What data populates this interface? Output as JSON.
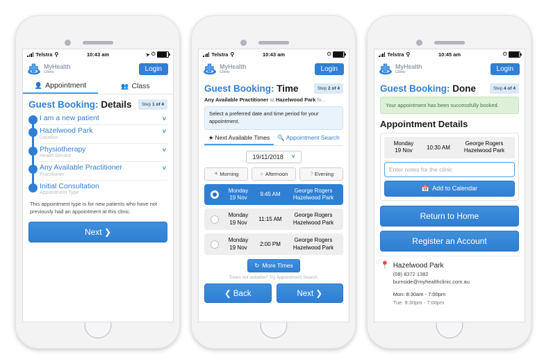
{
  "brand": {
    "name_line1": "MyHealth",
    "name_line2": "Clinic",
    "accent": "#2f7fd4",
    "logo_icon": "medical-cross-logo"
  },
  "common": {
    "login_label": "Login",
    "carrier": "Telstra",
    "wifi_icon": "wifi-icon",
    "signal_icon": "signal-bars-icon",
    "battery_icon": "battery-icon",
    "location_icon": "location-arrow-icon",
    "lock_icon": "rotation-lock-icon"
  },
  "phone1": {
    "status": {
      "time": "10:43 am"
    },
    "tabs": [
      {
        "label": "Appointment",
        "icon": "person-icon",
        "active": true
      },
      {
        "label": "Class",
        "icon": "group-icon",
        "active": false
      }
    ],
    "title_prefix": "Guest Booking:",
    "title_main": "Details",
    "step_prefix": "Step",
    "step_value": "1 of 4",
    "timeline": [
      {
        "label": "I am a new patient",
        "sub": "",
        "chevron": "chevron-down-icon"
      },
      {
        "label": "Hazelwood Park",
        "sub": "Location",
        "chevron": "chevron-down-icon"
      },
      {
        "label": "Physiotherapy",
        "sub": "Health Service",
        "chevron": "chevron-down-icon"
      },
      {
        "label": "Any Available Practitioner",
        "sub": "Practitioner",
        "chevron": "chevron-down-icon"
      },
      {
        "label": "Initial Consultation",
        "sub": "Appointment Type",
        "chevron": ""
      }
    ],
    "help_text": "This appointment type is for new patients who have not previously had an appointment at this clinic.",
    "next_label": "Next ❯"
  },
  "phone2": {
    "status": {
      "time": "10:43 am"
    },
    "title_prefix": "Guest Booking:",
    "title_main": "Time",
    "step_prefix": "Step",
    "step_value": "2 of 4",
    "subhead_practitioner": "Any Available Practitioner",
    "subhead_mid": " at ",
    "subhead_location": "Hazelwood Park",
    "subhead_tail": " fo...",
    "info_text": "Select a preferred date and time period for your appointment.",
    "tabs": [
      {
        "label": "Next Available Times",
        "icon": "star-icon",
        "active": true
      },
      {
        "label": "Appointment Search",
        "icon": "search-icon",
        "active": false
      }
    ],
    "date_value": "19/11/2018",
    "date_chevron": "chevron-down-icon",
    "periods": [
      {
        "label": "Morning",
        "icon": "sunrise-icon"
      },
      {
        "label": "Afternoon",
        "icon": "sun-icon"
      },
      {
        "label": "Evening",
        "icon": "moon-icon"
      }
    ],
    "slots": [
      {
        "day": "Monday",
        "date": "19 Nov",
        "time": "9:45 AM",
        "practitioner": "George Rogers",
        "location": "Hazelwood Park",
        "selected": true
      },
      {
        "day": "Monday",
        "date": "19 Nov",
        "time": "11:15 AM",
        "practitioner": "George Rogers",
        "location": "Hazelwood Park",
        "selected": false
      },
      {
        "day": "Monday",
        "date": "19 Nov",
        "time": "2:00 PM",
        "practitioner": "George Rogers",
        "location": "Hazelwood Park",
        "selected": false
      }
    ],
    "more_times_label": "More Times",
    "more_times_icon": "refresh-icon",
    "not_suitable_text": "Times not suitable? Try Appointment Search.",
    "back_label": "❮ Back",
    "next_label": "Next ❯"
  },
  "phone3": {
    "status": {
      "time": "10:45 am"
    },
    "title_prefix": "Guest Booking:",
    "title_main": "Done",
    "step_prefix": "Step",
    "step_value": "4 of 4",
    "success_text": "Your appointment has been successfully booked.",
    "section_title": "Appointment Details",
    "appointment": {
      "day": "Monday",
      "date": "19 Nov",
      "time": "10:30 AM",
      "practitioner": "George Rogers",
      "location": "Hazelwood Park"
    },
    "notes_placeholder": "Enter notes for the clinic",
    "notes_value": "",
    "add_calendar_label": "Add to Calendar",
    "add_calendar_icon": "calendar-plus-icon",
    "return_home_label": "Return to Home",
    "register_label": "Register an Account",
    "clinic": {
      "pin_icon": "map-pin-icon",
      "name": "Hazelwood Park",
      "phone": "(08) 8372 1382",
      "email": "burnside@myhealthclinic.com.au",
      "hours": [
        "Mon: 8:30am - 7:00pm",
        "Tue: 8:30pm - 7:00pm"
      ]
    }
  }
}
